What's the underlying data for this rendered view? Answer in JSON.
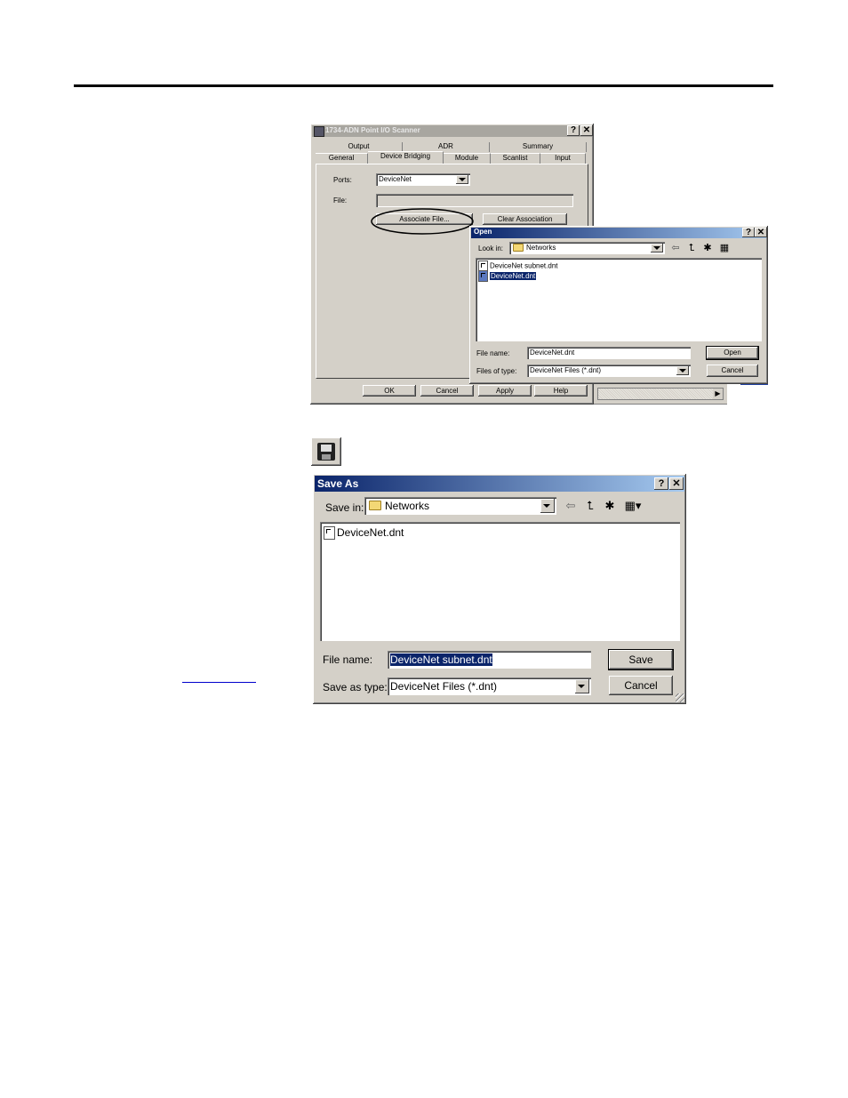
{
  "scanner": {
    "title": "1734-ADN Point I/O Scanner",
    "help_btn": "?",
    "close_btn": "✕",
    "tabs_row1": [
      "Output",
      "ADR",
      "Summary"
    ],
    "tabs_row2": [
      "General",
      "Device Bridging",
      "Module",
      "Scanlist",
      "Input"
    ],
    "ports_label": "Ports:",
    "ports_value": "DeviceNet",
    "file_label": "File:",
    "file_value": "",
    "associate_button": "Associate File...",
    "clear_button": "Clear Association",
    "ok_button": "OK",
    "cancel_button": "Cancel",
    "apply_button": "Apply",
    "help_button": "Help"
  },
  "open_dialog": {
    "title": "Open",
    "help_btn": "?",
    "close_btn": "✕",
    "look_in_label": "Look in:",
    "look_in_value": "Networks",
    "files": [
      "DeviceNet subnet.dnt",
      "DeviceNet.dnt"
    ],
    "selected_index": 1,
    "file_name_label": "File name:",
    "file_name_value": "DeviceNet.dnt",
    "files_of_type_label": "Files of type:",
    "files_of_type_value": "DeviceNet Files (*.dnt)",
    "open_button": "Open",
    "cancel_button": "Cancel"
  },
  "save_icon": "floppy-disk-icon",
  "save_dialog": {
    "title": "Save As",
    "help_btn": "?",
    "close_btn": "✕",
    "save_in_label": "Save in:",
    "save_in_value": "Networks",
    "files": [
      "DeviceNet.dnt"
    ],
    "file_name_label": "File name:",
    "file_name_value": "DeviceNet subnet.dnt",
    "save_as_type_label": "Save as type:",
    "save_as_type_value": "DeviceNet Files (*.dnt)",
    "save_button": "Save",
    "cancel_button": "Cancel"
  },
  "colors": {
    "selection": "#0a246a",
    "titlebar_active": "#0a246a",
    "titlebar_inactive": "#a8a6a0",
    "dialog_face": "#d4d0c8"
  }
}
